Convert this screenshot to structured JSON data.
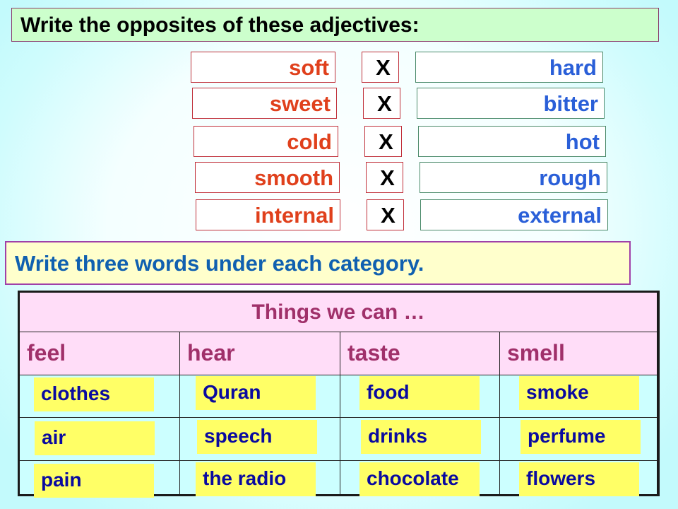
{
  "section1": {
    "title": "Write the opposites of these adjectives:",
    "separator": "X",
    "pairs": [
      {
        "word": "soft",
        "opposite": "hard"
      },
      {
        "word": "sweet",
        "opposite": "bitter"
      },
      {
        "word": "cold",
        "opposite": "hot"
      },
      {
        "word": "smooth",
        "opposite": "rough"
      },
      {
        "word": "internal",
        "opposite": "external"
      }
    ]
  },
  "section2": {
    "title": "Write three words under each category.",
    "table_title": "Things we can …",
    "columns": [
      "feel",
      "hear",
      "taste",
      "smell"
    ],
    "rows": [
      [
        "clothes",
        "Quran",
        "food",
        "smoke"
      ],
      [
        "air",
        "speech",
        "drinks",
        "perfume"
      ],
      [
        "pain",
        "the radio",
        "chocolate",
        "flowers"
      ]
    ]
  },
  "colors": {
    "word_color": "#e0401c",
    "opposite_color": "#2a5fd8",
    "header_color": "#a0306a",
    "answer_color": "#0a0aa0",
    "answer_highlight": "#ffff66"
  }
}
